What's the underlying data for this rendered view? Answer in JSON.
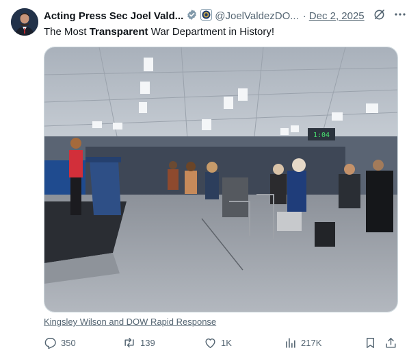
{
  "author": {
    "display_name": "Acting Press Sec Joel Vald...",
    "handle": "@JoelValdezDO...",
    "separator": "·",
    "date": "Dec 2, 2025"
  },
  "post": {
    "text_before": "The Most ",
    "text_bold": "Transparent",
    "text_after": " War Department in History!"
  },
  "media": {
    "credit": "Kingsley Wilson and DOW Rapid Response",
    "clock_readout": "1:04"
  },
  "actions": {
    "replies": "350",
    "reposts": "139",
    "likes": "1K",
    "views": "217K"
  },
  "colors": {
    "text_primary": "#0f1419",
    "text_secondary": "#536471",
    "verified_badge": "#829aab",
    "border": "#cfd9de"
  },
  "icons": [
    "verified-badge-icon",
    "affiliate-seal-icon",
    "grok-icon",
    "more-icon",
    "reply-icon",
    "repost-icon",
    "like-icon",
    "views-icon",
    "bookmark-icon",
    "share-icon"
  ]
}
